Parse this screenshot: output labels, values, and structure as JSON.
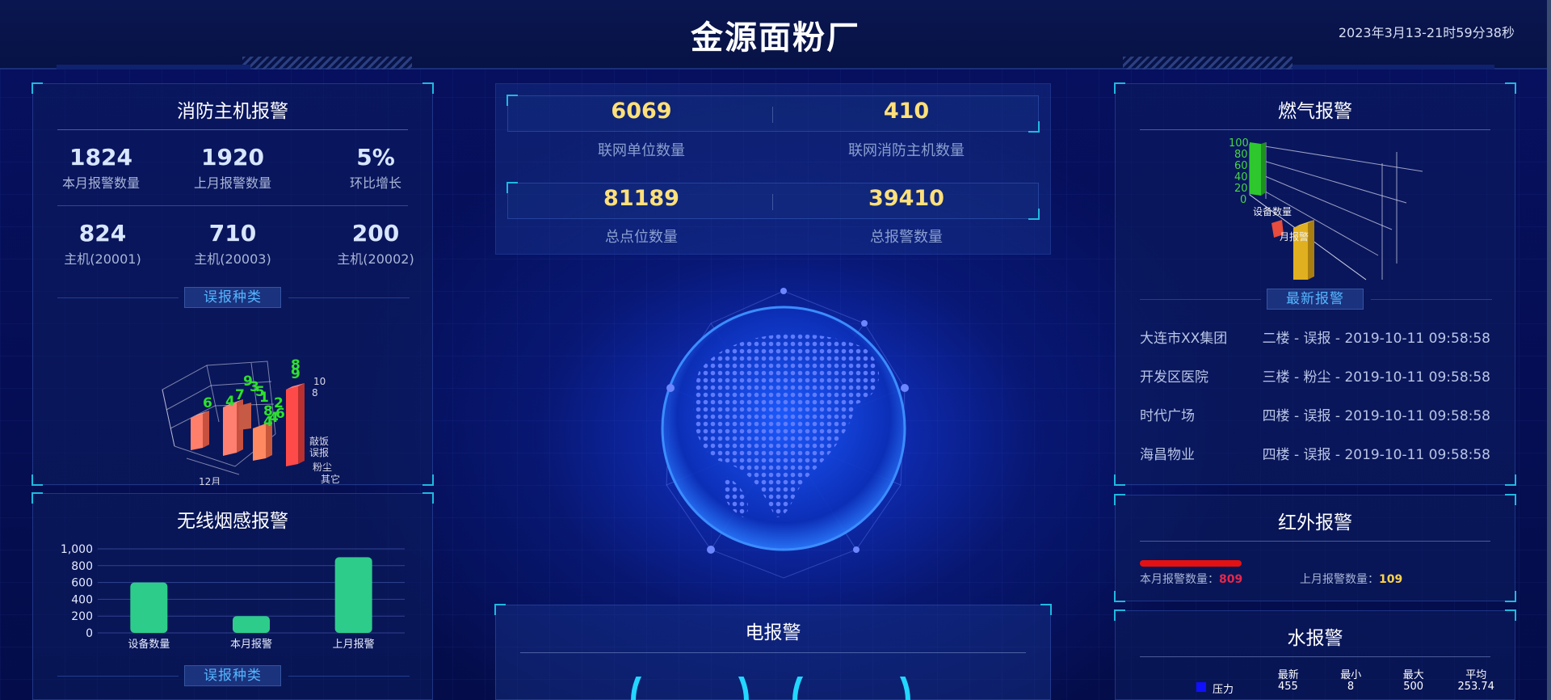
{
  "header": {
    "title": "金源面粉厂",
    "time": "2023年3月13-21时59分38秒"
  },
  "fire_host": {
    "title": "消防主机报警",
    "stats": [
      {
        "value": "1824",
        "label": "本月报警数量"
      },
      {
        "value": "1920",
        "label": "上月报警数量"
      },
      {
        "value": "5%",
        "label": "环比增长"
      },
      {
        "value": "824",
        "label": "主机(20001)"
      },
      {
        "value": "710",
        "label": "主机(20003)"
      },
      {
        "value": "200",
        "label": "主机(20002)"
      }
    ],
    "tag": "误报种类",
    "chart": {
      "axis_labels": [
        "10",
        "8",
        "敲饭",
        "误报",
        "粉尘",
        "其它",
        "12月"
      ],
      "bar_labels": [
        "6",
        "4",
        "7",
        "3",
        "9",
        "1",
        "8",
        "2",
        "4",
        "6",
        "5",
        "4",
        "9",
        "8"
      ]
    }
  },
  "wireless_smoke": {
    "title": "无线烟感报警",
    "tag": "误报种类",
    "chart_data": {
      "type": "bar",
      "categories": [
        "设备数量",
        "本月报警",
        "上月报警"
      ],
      "values": [
        600,
        200,
        900
      ],
      "ylim": [
        0,
        1000
      ],
      "yticks": [
        "0",
        "200",
        "400",
        "600",
        "800",
        "1,000"
      ],
      "bar_color": "#2ecc8a"
    }
  },
  "center": {
    "stats": [
      {
        "value": "6069",
        "label": "联网单位数量"
      },
      {
        "value": "410",
        "label": "联网消防主机数量"
      },
      {
        "value": "81189",
        "label": "总点位数量"
      },
      {
        "value": "39410",
        "label": "总报警数量"
      }
    ],
    "electric_title": "电报警"
  },
  "gas": {
    "title": "燃气报警",
    "chart": {
      "yticks": [
        "100",
        "80",
        "60",
        "40",
        "20",
        "0"
      ],
      "labels": [
        "设备数量",
        "月报警"
      ]
    },
    "tag": "最新报警",
    "news": [
      {
        "org": "大连市XX集团",
        "info": "二楼 - 误报 - 2019-10-11 09:58:58"
      },
      {
        "org": "开发区医院",
        "info": "三楼 - 粉尘 - 2019-10-11 09:58:58"
      },
      {
        "org": "时代广场",
        "info": "四楼 - 误报 - 2019-10-11 09:58:58"
      },
      {
        "org": "海昌物业",
        "info": "四楼 - 误报 - 2019-10-11 09:58:58"
      }
    ]
  },
  "infrared": {
    "title": "红外报警",
    "this_month_label": "本月报警数量：",
    "this_month_value": "809",
    "last_month_label": "上月报警数量：",
    "last_month_value": "109"
  },
  "water": {
    "title": "水报警",
    "headers": [
      "最新",
      "最小",
      "最大",
      "平均"
    ],
    "rows": [
      {
        "name": "压力",
        "color": "#1010ff",
        "values": [
          "455",
          "8",
          "500",
          "253.74"
        ]
      }
    ]
  }
}
